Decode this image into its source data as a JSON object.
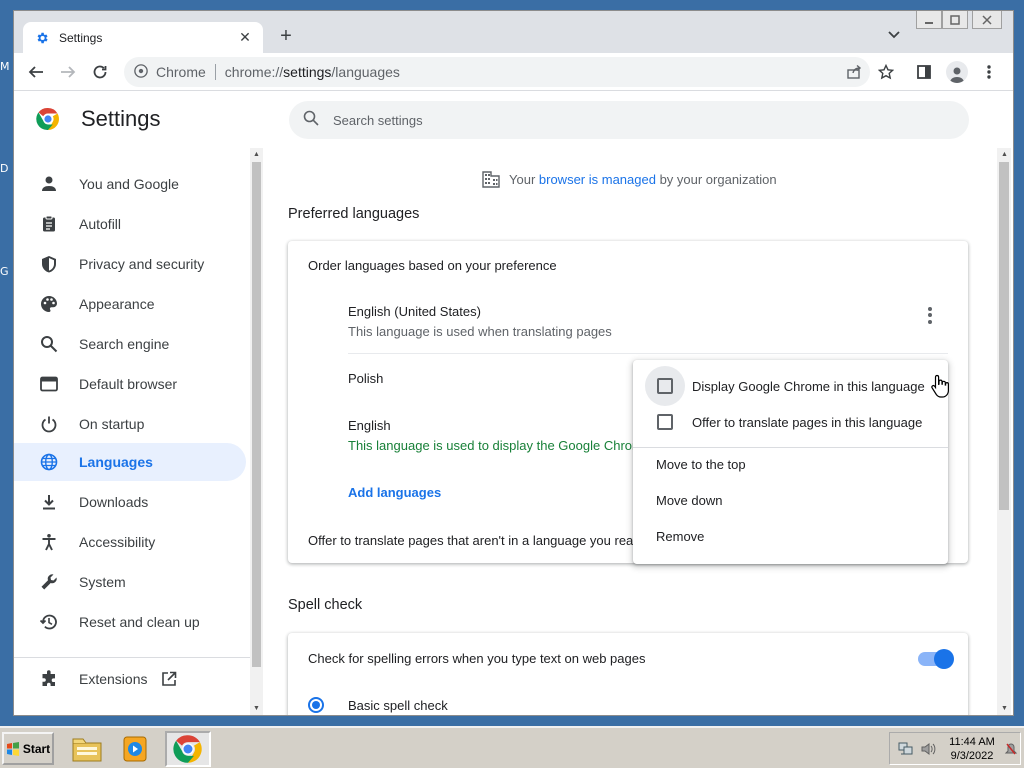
{
  "desktop": {
    "fragments": [
      "M",
      "D",
      "G"
    ]
  },
  "tab": {
    "title": "Settings",
    "close": "✕"
  },
  "newtab": "+",
  "address": {
    "site_label": "Chrome",
    "url_scheme": "chrome://",
    "url_host": "settings",
    "url_path": "/languages"
  },
  "header": {
    "title": "Settings",
    "search_placeholder": "Search settings"
  },
  "sidebar": {
    "items": [
      {
        "label": "You and Google",
        "icon": "person-icon"
      },
      {
        "label": "Autofill",
        "icon": "clipboard-icon"
      },
      {
        "label": "Privacy and security",
        "icon": "shield-icon"
      },
      {
        "label": "Appearance",
        "icon": "palette-icon"
      },
      {
        "label": "Search engine",
        "icon": "search-icon"
      },
      {
        "label": "Default browser",
        "icon": "browser-window-icon"
      },
      {
        "label": "On startup",
        "icon": "power-icon"
      },
      {
        "label": "Languages",
        "icon": "globe-icon",
        "active": true
      },
      {
        "label": "Downloads",
        "icon": "download-icon"
      },
      {
        "label": "Accessibility",
        "icon": "accessibility-icon"
      },
      {
        "label": "System",
        "icon": "wrench-icon"
      },
      {
        "label": "Reset and clean up",
        "icon": "history-icon"
      }
    ],
    "extensions": {
      "label": "Extensions",
      "icon": "puzzle-icon"
    }
  },
  "managed": {
    "prefix": "Your ",
    "link": "browser is managed",
    "suffix": " by your organization"
  },
  "preferred": {
    "title": "Preferred languages",
    "order_text": "Order languages based on your preference",
    "languages": [
      {
        "name": "English (United States)",
        "note": "This language is used when translating pages"
      },
      {
        "name": "Polish",
        "note": ""
      },
      {
        "name": "English",
        "note": "This language is used to display the Google Chrom"
      }
    ],
    "add_languages": "Add languages",
    "offer_translate": "Offer to translate pages that aren't in a language you rea"
  },
  "context_menu": {
    "display_chrome": "Display Google Chrome in this language",
    "offer_translate": "Offer to translate pages in this language",
    "move_top": "Move to the top",
    "move_down": "Move down",
    "remove": "Remove"
  },
  "spellcheck": {
    "title": "Spell check",
    "check_text": "Check for spelling errors when you type text on web pages",
    "basic": "Basic spell check",
    "enabled": true
  },
  "taskbar": {
    "start": "Start",
    "time": "11:44 AM",
    "date": "9/3/2022"
  },
  "colors": {
    "accent": "#1a73e8",
    "green_note": "#188038",
    "active_nav_bg": "#e8f0fe"
  }
}
